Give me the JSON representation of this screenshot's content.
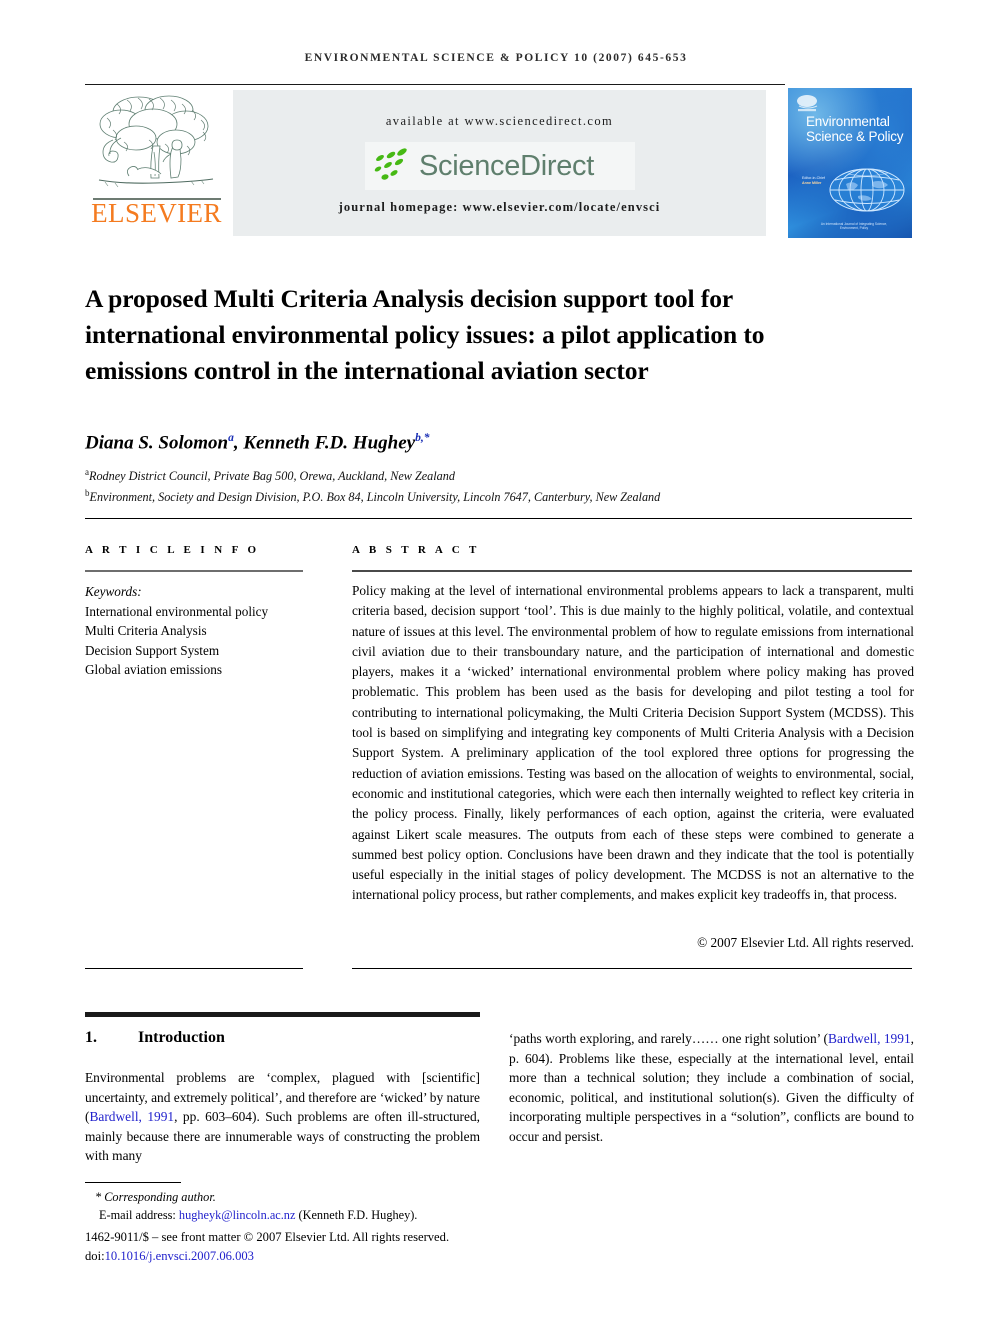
{
  "running_head": "ENVIRONMENTAL SCIENCE & POLICY 10 (2007) 645-653",
  "masthead": {
    "publisher_name": "ELSEVIER",
    "available_at": "available at www.sciencedirect.com",
    "sciencedirect_wordmark": "ScienceDirect",
    "journal_homepage": "journal homepage: www.elsevier.com/locate/envsci",
    "cover": {
      "publisher_mark": "ELSEVIER",
      "title": "Environmental Science & Policy",
      "editor_label": "Editor-in-Chief",
      "editor_name": "Anne Miller",
      "footer": "An International Journal of Integrating Science, Environment, Policy"
    }
  },
  "article": {
    "title": "A proposed Multi Criteria Analysis decision support tool for international environmental policy issues: a pilot application to emissions control in the international aviation sector",
    "authors_html": "Diana S. Solomon<sup>a</sup>, Kenneth F.D. Hughey<sup>b,*</sup>",
    "affiliations": [
      {
        "marker": "a",
        "text": "Rodney District Council, Private Bag 500, Orewa, Auckland, New Zealand"
      },
      {
        "marker": "b",
        "text": "Environment, Society and Design Division, P.O. Box 84, Lincoln University, Lincoln 7647, Canterbury, New Zealand"
      }
    ]
  },
  "info": {
    "heading": "A R T I C L E   I N F O",
    "keywords_label": "Keywords:",
    "keywords": [
      "International environmental policy",
      "Multi Criteria Analysis",
      "Decision Support System",
      "Global aviation emissions"
    ]
  },
  "abstract": {
    "heading": "A B S T R A C T",
    "text": "Policy making at the level of international environmental problems appears to lack a transparent, multi criteria based, decision support ‘tool’. This is due mainly to the highly political, volatile, and contextual nature of issues at this level. The environmental problem of how to regulate emissions from international civil aviation due to their transboundary nature, and the participation of international and domestic players, makes it a ‘wicked’ international environmental problem where policy making has proved problematic. This problem has been used as the basis for developing and pilot testing a tool for contributing to international policymaking, the Multi Criteria Decision Support System (MCDSS). This tool is based on simplifying and integrating key components of Multi Criteria Analysis with a Decision Support System. A preliminary application of the tool explored three options for progressing the reduction of aviation emissions. Testing was based on the allocation of weights to environmental, social, economic and institutional categories, which were each then internally weighted to reflect key criteria in the policy process. Finally, likely performances of each option, against the criteria, were evaluated against Likert scale measures. The outputs from each of these steps were combined to generate a summed best policy option. Conclusions have been drawn and they indicate that the tool is potentially useful especially in the initial stages of policy development. The MCDSS is not an alternative to the international policy process, but rather complements, and makes explicit key tradeoffs in, that process.",
    "copyright": "© 2007 Elsevier Ltd. All rights reserved."
  },
  "body": {
    "section_number": "1.",
    "section_title": "Introduction",
    "left_column_html": "Environmental problems are ‘complex, plagued with [scientific] uncertainty, and extremely political’, and therefore are ‘wicked’ by nature (<a class=\"cite\" href=\"#\" data-name=\"citation-link\" data-interactable=\"true\">Bardwell, 1991</a>, pp. 603–604). Such problems are often ill-structured, mainly because there are innumerable ways of constructing the problem with many",
    "right_column_html": "‘paths worth exploring, and rarely…… one right solution’ (<a class=\"cite\" href=\"#\" data-name=\"citation-link\" data-interactable=\"true\">Bardwell, 1991</a>, p. 604). Problems like these, especially at the international level, entail more than a technical solution; they include a combination of social, economic, political, and institutional solution(s). Given the difficulty of incorporating multiple perspectives in a “solution”, conflicts are bound to occur and persist."
  },
  "footer": {
    "corresponding_author": "* Corresponding author.",
    "email_label": "E-mail address:",
    "email": "hugheyk@lincoln.ac.nz",
    "email_owner": "(Kenneth F.D. Hughey).",
    "front_matter": "1462-9011/$ – see front matter © 2007 Elsevier Ltd. All rights reserved.",
    "doi_label": "doi:",
    "doi": "10.1016/j.envsci.2007.06.003"
  },
  "colors": {
    "elsevier_orange": "#F47B20",
    "sciencedirect_green": "#4CBB17",
    "sciencedirect_text": "#5f7f6d",
    "link_blue": "#2222cc",
    "superscript_blue": "#1b30b5",
    "band_gray": "#eaedee",
    "cover_blue": "#1c62c2"
  }
}
